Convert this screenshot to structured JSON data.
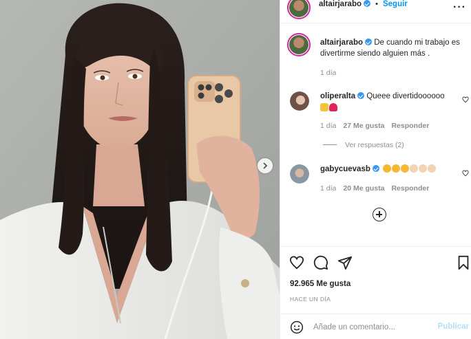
{
  "post": {
    "author": "altairjarabo",
    "follow_label": "Seguir",
    "more_label": "···",
    "caption": "De cuando mi trabajo es divertirme siendo alguien más .",
    "caption_time": "1 día"
  },
  "comments": [
    {
      "user": "oliperalta",
      "text": "Queee divertidoooooo",
      "emojis": [
        "raising-hands",
        "red-heart"
      ],
      "time": "1 día",
      "likes": "27 Me gusta",
      "reply_label": "Responder",
      "view_replies": "Ver respuestas (2)"
    },
    {
      "user": "gabycuevasb",
      "text": "",
      "emojis": [
        "star-struck",
        "star-struck",
        "star-struck",
        "clapping-hands",
        "clapping-hands",
        "clapping-hands"
      ],
      "time": "1 día",
      "likes": "20 Me gusta",
      "reply_label": "Responder"
    }
  ],
  "footer": {
    "likes": "92.965 Me gusta",
    "posted_ago": "HACE UN DÍA",
    "comment_placeholder": "Añade un comentario...",
    "post_label": "Publicar"
  },
  "colors": {
    "link_blue": "#0095f6",
    "verified_blue": "#3897f0",
    "muted": "#8e8e8e",
    "post_disabled": "#b2dffc"
  }
}
